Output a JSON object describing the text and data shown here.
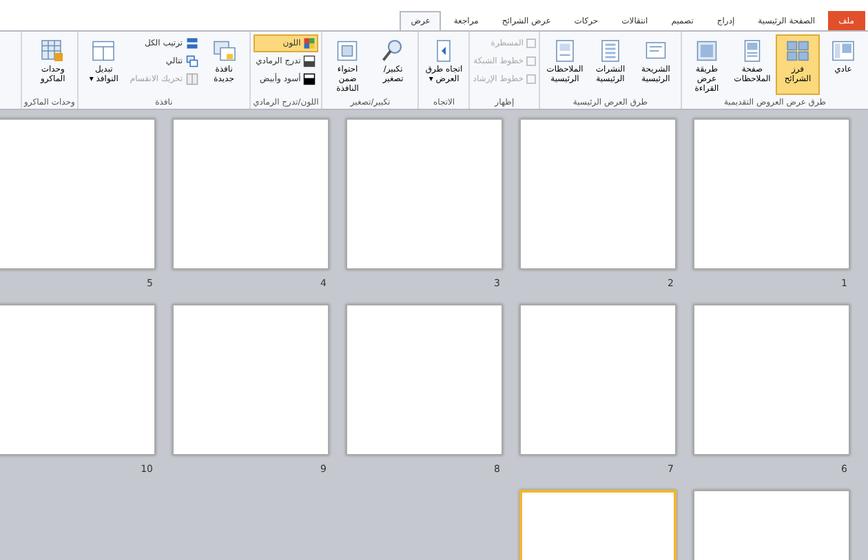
{
  "tabs": [
    {
      "label": "ملف",
      "kind": "file",
      "selected": false
    },
    {
      "label": "الصفحة الرئيسية",
      "kind": "tab",
      "selected": false
    },
    {
      "label": "إدراج",
      "kind": "tab",
      "selected": false
    },
    {
      "label": "تصميم",
      "kind": "tab",
      "selected": false
    },
    {
      "label": "انتقالات",
      "kind": "tab",
      "selected": false
    },
    {
      "label": "حركات",
      "kind": "tab",
      "selected": false
    },
    {
      "label": "عرض الشرائح",
      "kind": "tab",
      "selected": false
    },
    {
      "label": "مراجعة",
      "kind": "tab",
      "selected": false
    },
    {
      "label": "عرض",
      "kind": "tab",
      "selected": true
    }
  ],
  "groups": [
    {
      "label": "طرق عرض العروض التقديمية",
      "columns": [
        [
          {
            "kind": "large",
            "label": "عادي",
            "selected": false
          }
        ],
        [
          {
            "kind": "large",
            "label": "فرز الشرائح",
            "selected": true
          }
        ],
        [
          {
            "kind": "large",
            "label": "صفحة الملاحظات",
            "selected": false
          }
        ],
        [
          {
            "kind": "large",
            "label": "طريقة عرض القراءة",
            "selected": false
          }
        ]
      ]
    },
    {
      "label": "طرق العرض الرئيسية",
      "columns": [
        [
          {
            "kind": "large",
            "label": "الشريحة الرئيسية"
          }
        ],
        [
          {
            "kind": "large",
            "label": "النشرات الرئيسية"
          }
        ],
        [
          {
            "kind": "large",
            "label": "الملاحظات الرئيسية"
          }
        ]
      ]
    },
    {
      "label": "إظهار",
      "columns": [
        [
          {
            "kind": "check",
            "label": "المسطرة",
            "checked": false,
            "disabled": true
          },
          {
            "kind": "check",
            "label": "خطوط الشبكة",
            "checked": false,
            "disabled": true
          },
          {
            "kind": "check",
            "label": "خطوط الإرشاد",
            "checked": false,
            "disabled": true
          }
        ]
      ]
    },
    {
      "label": "الاتجاه",
      "columns": [
        [
          {
            "kind": "large",
            "label": "اتجاه طرق العرض ▾"
          }
        ]
      ]
    },
    {
      "label": "تكبير/تصغير",
      "columns": [
        [
          {
            "kind": "large",
            "label": "تكبير/تصغير"
          }
        ],
        [
          {
            "kind": "large",
            "label": "احتواء ضمن النافذة"
          }
        ]
      ]
    },
    {
      "label": "اللون/تدرج الرمادي",
      "columns": [
        [
          {
            "kind": "small",
            "label": "اللون",
            "selected": true
          },
          {
            "kind": "small",
            "label": "تدرج الرمادي",
            "selected": false
          },
          {
            "kind": "small",
            "label": "أسود وأبيض",
            "selected": false
          }
        ]
      ]
    },
    {
      "label": "نافذة",
      "columns": [
        [
          {
            "kind": "large",
            "label": "نافذة جديدة"
          }
        ],
        [
          {
            "kind": "small",
            "label": "ترتيب الكل",
            "disabled": false
          },
          {
            "kind": "small",
            "label": "تتالي",
            "disabled": false
          },
          {
            "kind": "small",
            "label": "تحريك الانقسام",
            "disabled": true
          }
        ],
        [
          {
            "kind": "large",
            "label": "تبديل النوافذ ▾"
          }
        ]
      ]
    },
    {
      "label": "وحدات الماكرو",
      "columns": [
        [
          {
            "kind": "large",
            "label": "وحدات الماكرو"
          }
        ]
      ]
    }
  ],
  "slides": [
    {
      "number": "1",
      "selected": false
    },
    {
      "number": "2",
      "selected": false
    },
    {
      "number": "3",
      "selected": false
    },
    {
      "number": "4",
      "selected": false
    },
    {
      "number": "5",
      "selected": false
    },
    {
      "number": "6",
      "selected": false
    },
    {
      "number": "7",
      "selected": false
    },
    {
      "number": "8",
      "selected": false
    },
    {
      "number": "9",
      "selected": false
    },
    {
      "number": "10",
      "selected": false
    },
    {
      "selected": false
    },
    {
      "selected": true
    }
  ]
}
